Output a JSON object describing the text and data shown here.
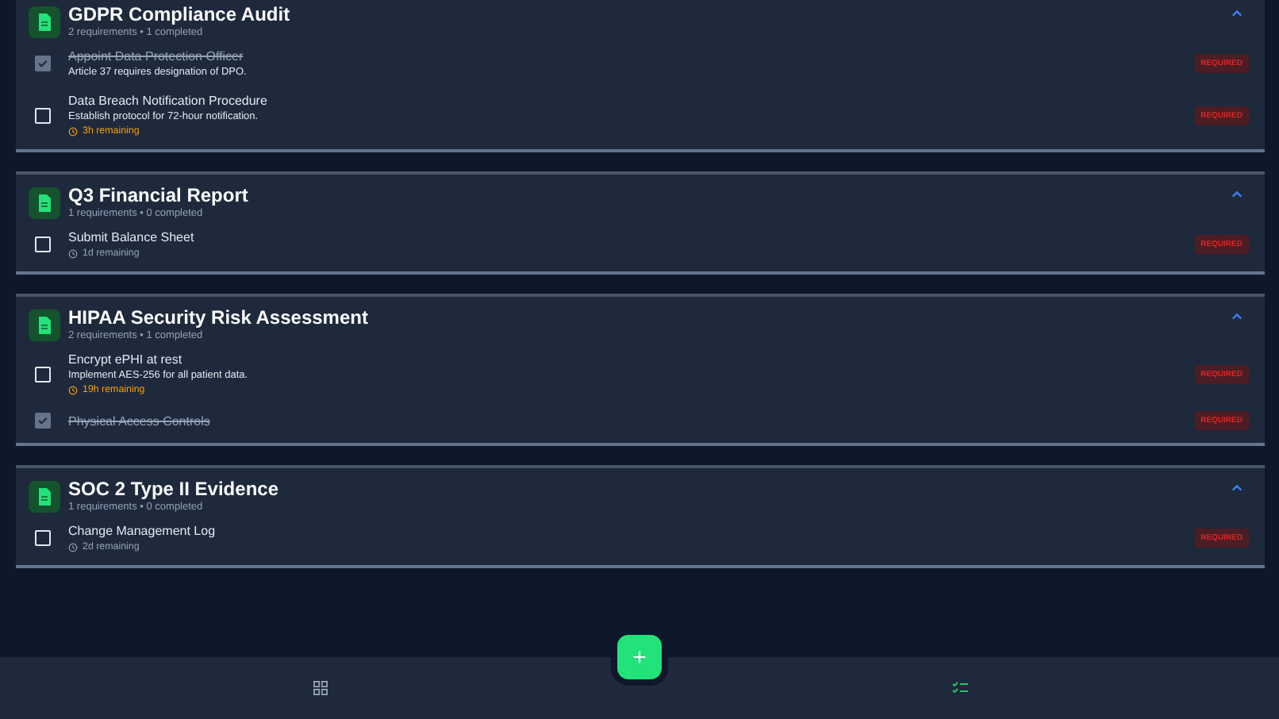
{
  "groups": [
    {
      "title": "GDPR Compliance Audit",
      "summary": "2 requirements • 1 completed",
      "expanded": true,
      "items": [
        {
          "title": "Appoint Data Protection Officer",
          "description": "Article 37 requires designation of DPO.",
          "checked": true,
          "badge": "REQUIRED"
        },
        {
          "title": "Data Breach Notification Procedure",
          "description": "Establish protocol for 72-hour notification.",
          "checked": false,
          "remaining": "3h remaining",
          "urgent": true,
          "badge": "REQUIRED"
        }
      ]
    },
    {
      "title": "Q3 Financial Report",
      "summary": "1 requirements • 0 completed",
      "expanded": true,
      "items": [
        {
          "title": "Submit Balance Sheet",
          "checked": false,
          "remaining": "1d remaining",
          "urgent": false,
          "badge": "REQUIRED"
        }
      ]
    },
    {
      "title": "HIPAA Security Risk Assessment",
      "summary": "2 requirements • 1 completed",
      "expanded": true,
      "items": [
        {
          "title": "Encrypt ePHI at rest",
          "description": "Implement AES-256 for all patient data.",
          "checked": false,
          "remaining": "19h remaining",
          "urgent": true,
          "badge": "REQUIRED"
        },
        {
          "title": "Physical Access Controls",
          "checked": true,
          "badge": "REQUIRED"
        }
      ]
    },
    {
      "title": "SOC 2 Type II Evidence",
      "summary": "1 requirements • 0 completed",
      "expanded": true,
      "items": [
        {
          "title": "Change Management Log",
          "checked": false,
          "remaining": "2d remaining",
          "urgent": false,
          "badge": "REQUIRED"
        }
      ]
    }
  ],
  "add_button": "+",
  "nav": [
    {
      "kind": "grid",
      "selected": false
    },
    {
      "kind": "checklist",
      "selected": true
    }
  ]
}
